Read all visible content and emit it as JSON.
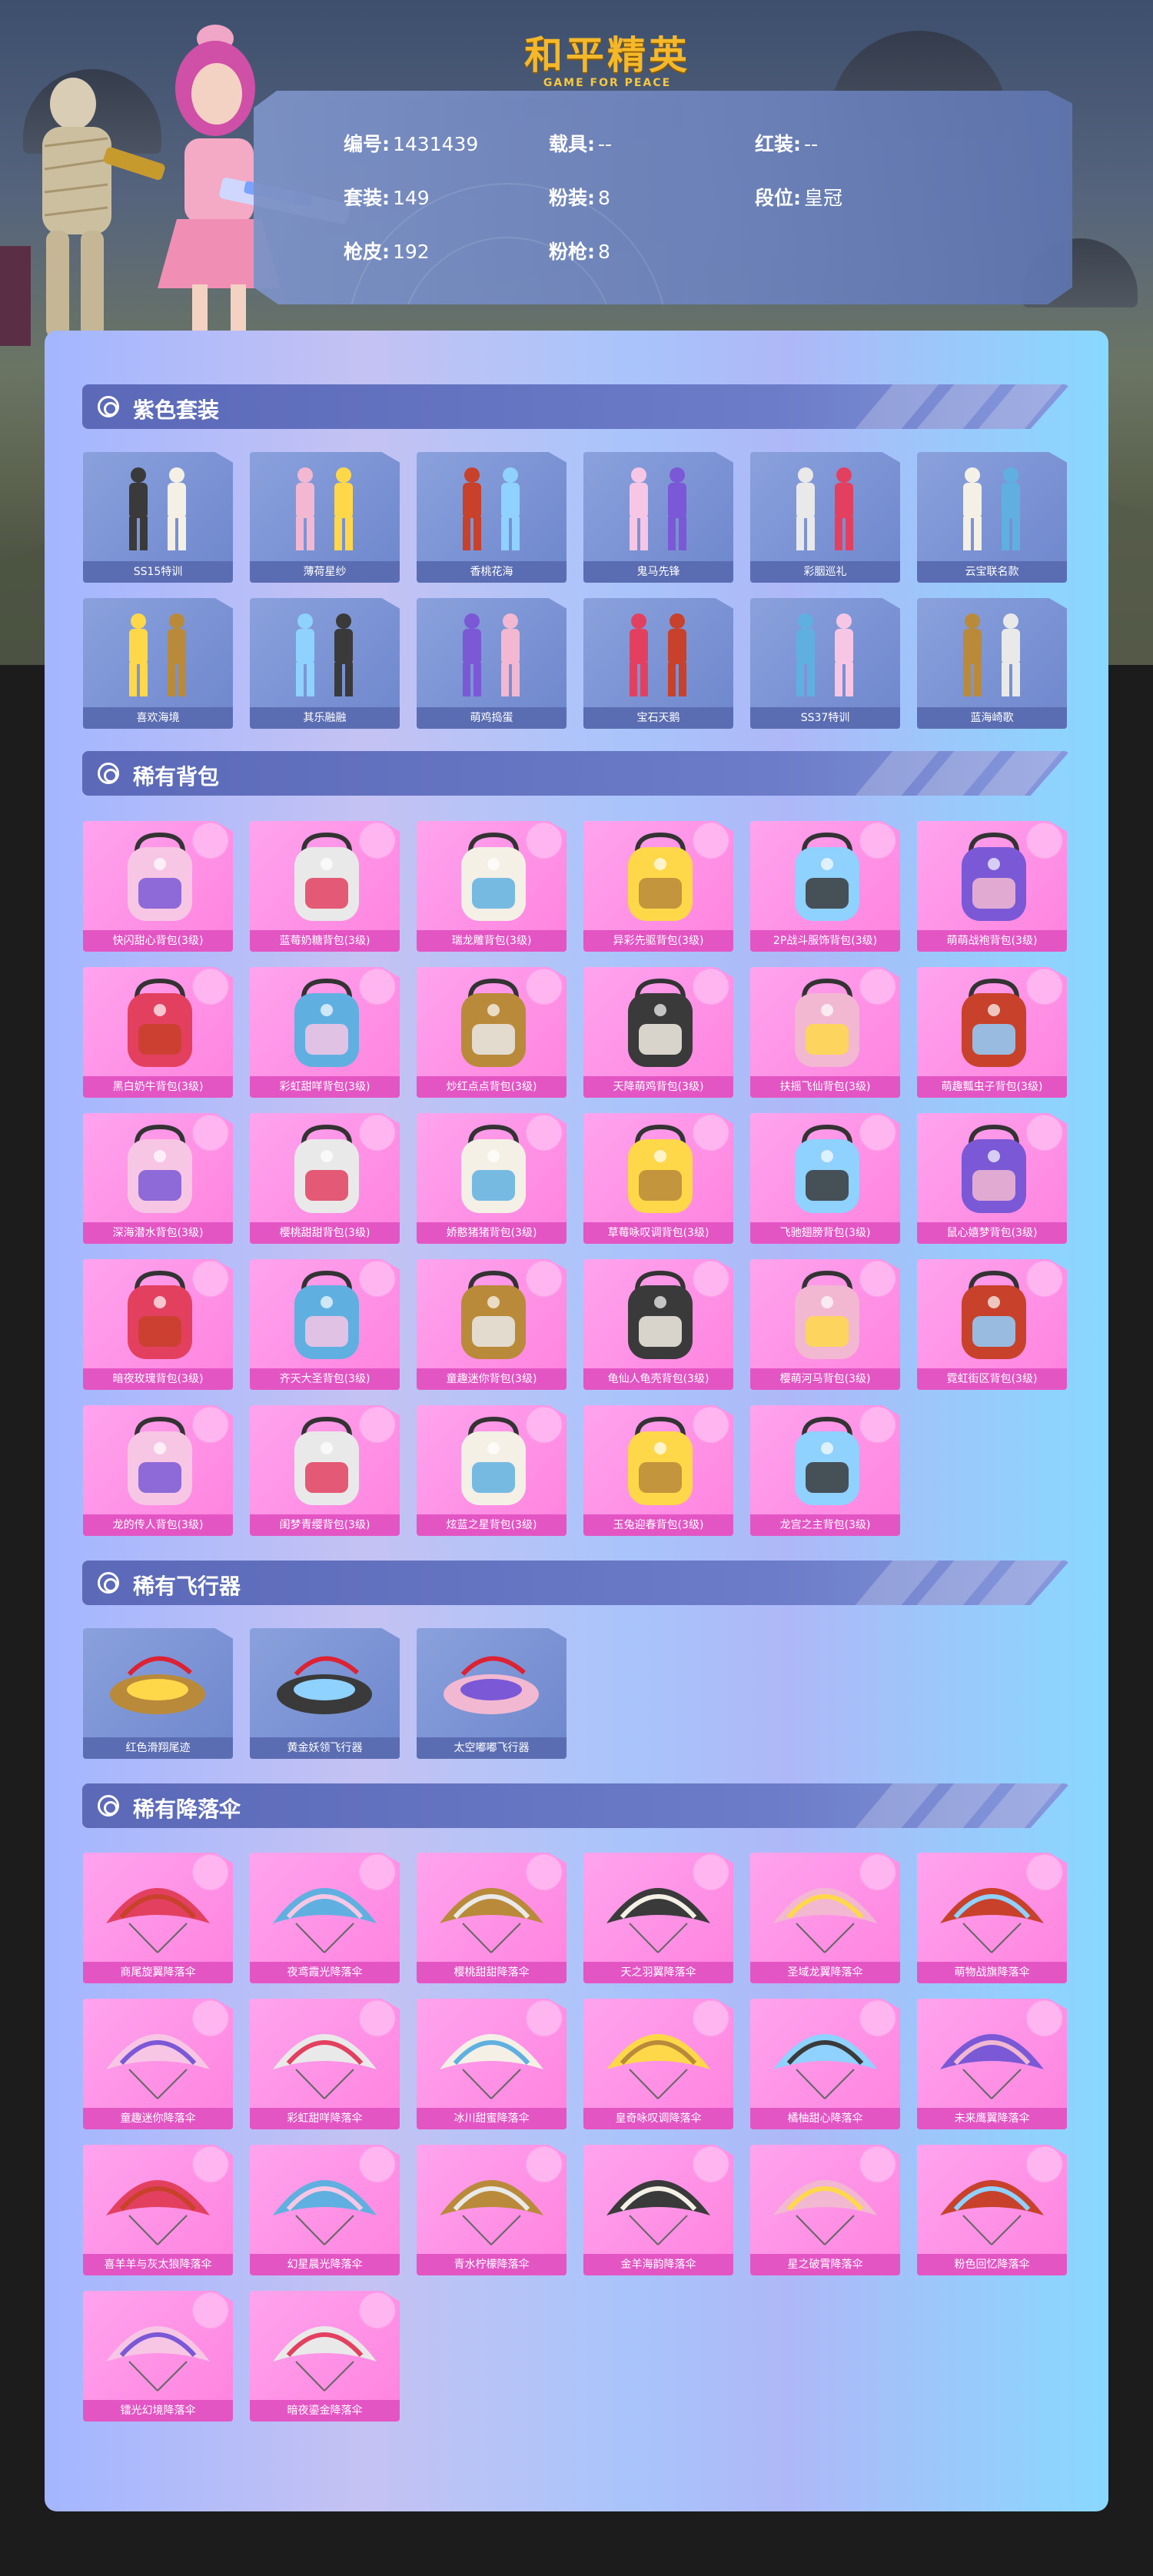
{
  "header": {
    "logo_title": "和平精英",
    "logo_subtitle": "GAME FOR PEACE"
  },
  "info": [
    {
      "key": "编号:",
      "value": "1431439"
    },
    {
      "key": "载具:",
      "value": "--"
    },
    {
      "key": "红装:",
      "value": "--"
    },
    {
      "key": "套装:",
      "value": "149"
    },
    {
      "key": "粉装:",
      "value": "8"
    },
    {
      "key": "段位:",
      "value": "皇冠"
    },
    {
      "key": "枪皮:",
      "value": "192"
    },
    {
      "key": "粉枪:",
      "value": "8"
    }
  ],
  "sections": [
    {
      "title": "紫色套装",
      "style": "blue",
      "icon": "outfit",
      "items": [
        "SS15特训",
        "薄荷星纱",
        "香桃花海",
        "鬼马先锋",
        "彩胭巡礼",
        "云宝联名款",
        "喜欢海境",
        "其乐融融",
        "萌鸡捣蛋",
        "宝石天鹅",
        "SS37特训",
        "蓝海崎歌"
      ]
    },
    {
      "title": "稀有背包",
      "style": "pink",
      "icon": "backpack",
      "items": [
        "快闪甜心背包(3级)",
        "蓝莓奶糖背包(3级)",
        "瑞龙雕背包(3级)",
        "异彩先驱背包(3级)",
        "2P战斗服饰背包(3级)",
        "萌萌战袍背包(3级)",
        "黑白奶牛背包(3级)",
        "彩虹甜咩背包(3级)",
        "炒红点点背包(3级)",
        "天降萌鸡背包(3级)",
        "扶摇飞仙背包(3级)",
        "萌趣瓢虫子背包(3级)",
        "深海潜水背包(3级)",
        "樱桃甜甜背包(3级)",
        "娇憨猪猪背包(3级)",
        "草莓咏叹调背包(3级)",
        "飞驰翅膀背包(3级)",
        "鼠心嬉梦背包(3级)",
        "暗夜玫瑰背包(3级)",
        "齐天大圣背包(3级)",
        "童趣迷你背包(3级)",
        "龟仙人龟壳背包(3级)",
        "樱萌河马背包(3级)",
        "霓虹街区背包(3级)",
        "龙的传人背包(3级)",
        "闺梦青缨背包(3级)",
        "炫蓝之星背包(3级)",
        "玉兔迎春背包(3级)",
        "龙宫之主背包(3级)"
      ]
    },
    {
      "title": "稀有飞行器",
      "style": "blue",
      "icon": "glider",
      "items": [
        "红色滑翔尾迹",
        "黄金妖领飞行器",
        "太空嘟嘟飞行器"
      ]
    },
    {
      "title": "稀有降落伞",
      "style": "pink",
      "icon": "parachute",
      "items": [
        "商尾旋翼降落伞",
        "夜鸢霞光降落伞",
        "樱桃甜甜降落伞",
        "天之羽翼降落伞",
        "圣域龙翼降落伞",
        "萌物战旗降落伞",
        "童趣迷你降落伞",
        "彩虹甜咩降落伞",
        "冰川甜蜜降落伞",
        "皇奇咏叹调降落伞",
        "橘柚甜心降落伞",
        "未来鹰翼降落伞",
        "喜羊羊与灰太狼降落伞",
        "幻星晨光降落伞",
        "青水柠檬降落伞",
        "金羊海韵降落伞",
        "星之破霄降落伞",
        "粉色回忆降落伞",
        "镭光幻境降落伞",
        "暗夜鎏金降落伞"
      ]
    }
  ],
  "colors": {
    "accent": "#5b69b8",
    "pink_tile": "#ff8ee2",
    "blue_tile": "#7d94d4",
    "logo": "#f5b82a"
  }
}
